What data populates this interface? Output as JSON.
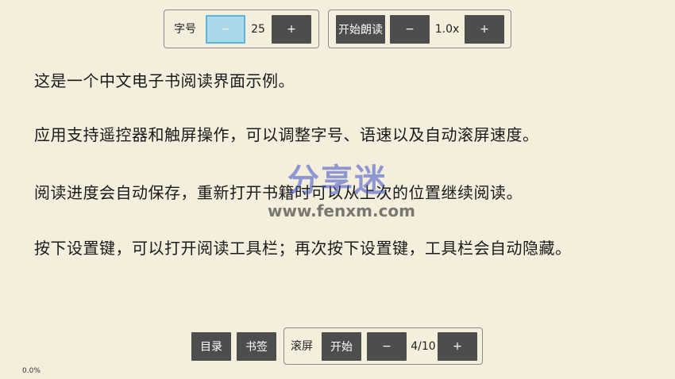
{
  "font_panel": {
    "label": "字号",
    "minus": "−",
    "value": "25",
    "plus": "+"
  },
  "speech_panel": {
    "start": "开始朗读",
    "minus": "−",
    "value": "1.0x",
    "plus": "+"
  },
  "content": {
    "paragraphs": [
      "这是一个中文电子书阅读界面示例。",
      "应用支持遥控器和触屏操作，可以调整字号、语速以及自动滚屏速度。",
      "阅读进度会自动保存，重新打开书籍时可以从上次的位置继续阅读。",
      "按下设置键，可以打开阅读工具栏；再次按下设置键，工具栏会自动隐藏。"
    ]
  },
  "bottom_bar": {
    "toc": "目录",
    "bookmark": "书签",
    "scroll_label": "滚屏",
    "scroll_start": "开始",
    "minus": "−",
    "page": "4/10",
    "plus": "+"
  },
  "progress": "0.0%",
  "watermark": {
    "text": "分享迷",
    "url": "www.fenxm.com"
  },
  "colors": {
    "background": "#f4eedc",
    "button": "#4d4d4d",
    "selected": "#a8d8ea"
  }
}
